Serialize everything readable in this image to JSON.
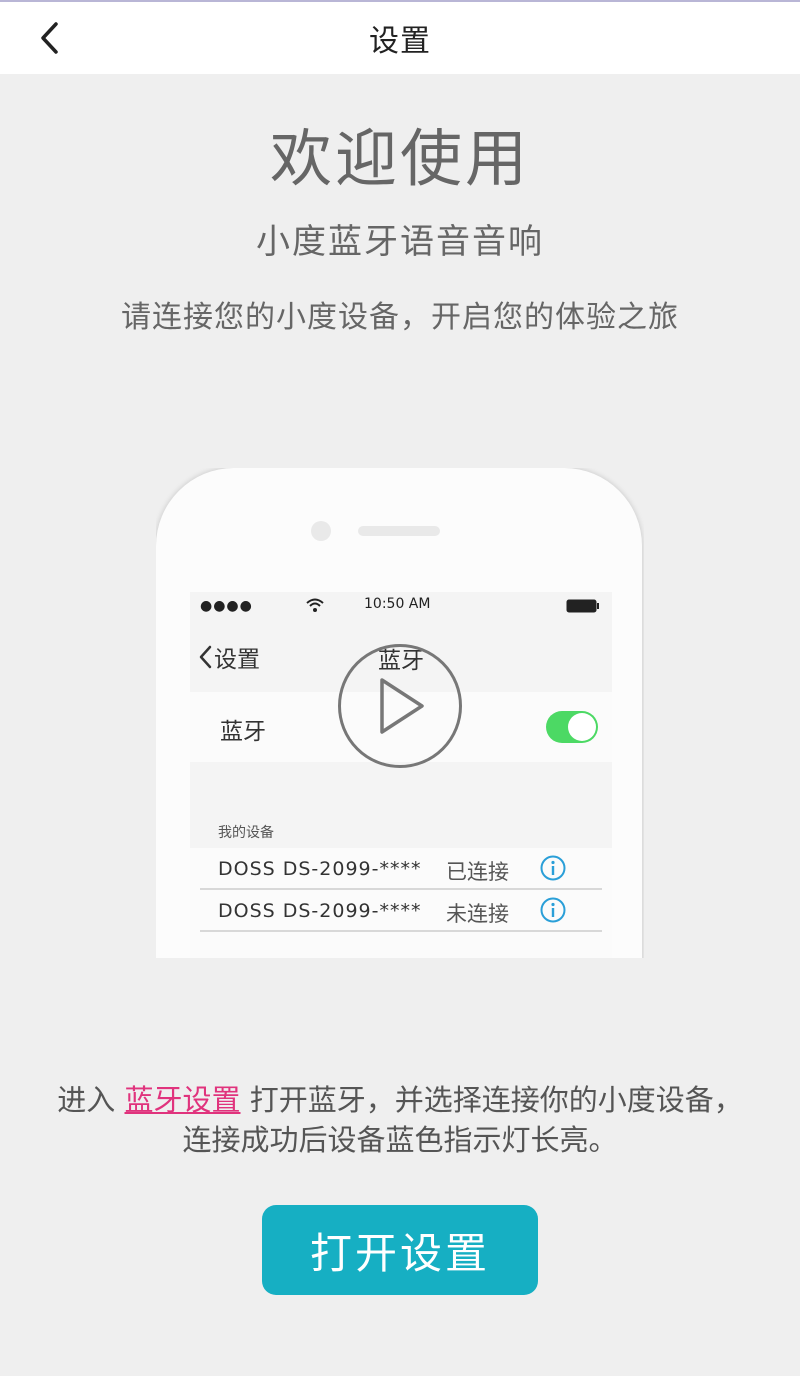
{
  "nav": {
    "title": "设置",
    "back_icon": "chevron-left-icon"
  },
  "hero": {
    "welcome": "欢迎使用",
    "product": "小度蓝牙语音音响",
    "subtitle": "请连接您的小度设备，开启您的体验之旅"
  },
  "illustration": {
    "status_bar": {
      "signal": "●●●●",
      "time": "10:50 AM",
      "wifi_icon": "wifi-icon",
      "battery_icon": "battery-icon"
    },
    "back_label": "设置",
    "screen_title": "蓝牙",
    "bluetooth_label": "蓝牙",
    "bluetooth_on": true,
    "my_devices_label": "我的设备",
    "devices": [
      {
        "name": "DOSS DS-2099-****",
        "status": "已连接"
      },
      {
        "name": "DOSS DS-2099-****",
        "status": "未连接"
      }
    ],
    "play_icon": "play-icon"
  },
  "instruction": {
    "prefix": "进入",
    "link": "蓝牙设置",
    "line1_rest": "打开蓝牙，并选择连接你的小度设备，",
    "line2": "连接成功后设备蓝色指示灯长亮。"
  },
  "action": {
    "open_settings_label": "打开设置"
  },
  "colors": {
    "background": "#efefef",
    "button": "#16afc3",
    "link": "#e0337d",
    "toggle_on": "#4cd964",
    "info": "#2a9fd8"
  }
}
